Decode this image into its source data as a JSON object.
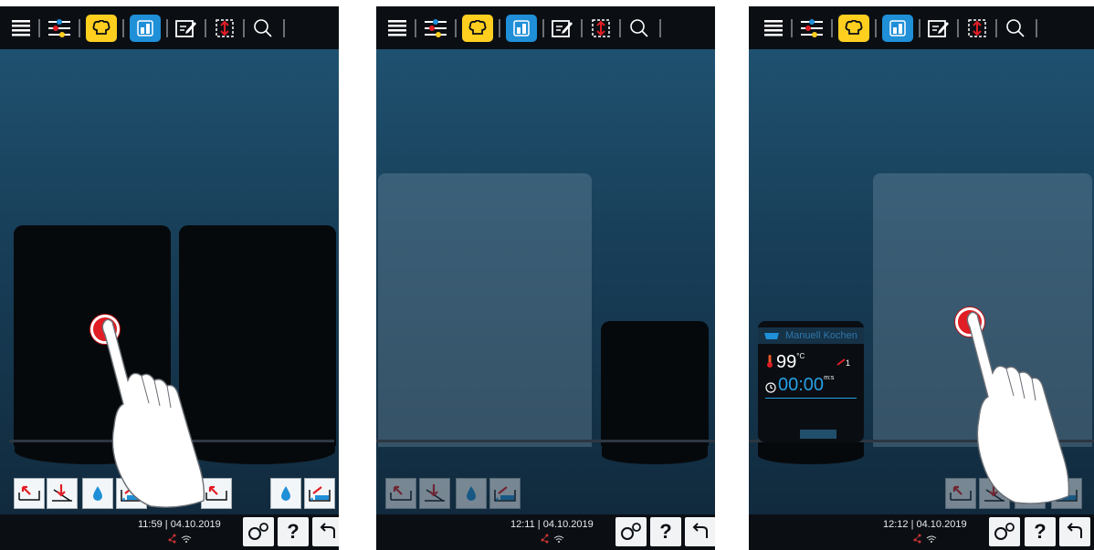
{
  "toolbar": {
    "icons": [
      "menu-icon",
      "sliders-icon",
      "chef-hat-icon",
      "ipanel-icon",
      "notes-icon",
      "resize-icon",
      "search-icon"
    ],
    "colors": {
      "yellow": "#ffcf1f",
      "blue": "#1f8fd8",
      "bar": "#0b0f14"
    }
  },
  "panels": [
    {
      "time": "11:59",
      "date": "04.10.2019",
      "bottom_buttons": [
        "lid-open-icon",
        "lid-close-icon",
        "water-drop-icon",
        "water-fill-icon",
        "lid-open-icon",
        "water-drop-icon",
        "water-fill-icon"
      ]
    },
    {
      "time": "12:11",
      "date": "04.10.2019",
      "bottom_buttons": [
        "lid-open-icon",
        "lid-close-icon",
        "water-drop-icon",
        "water-fill-icon"
      ]
    },
    {
      "time": "12:12",
      "date": "04.10.2019",
      "card": {
        "title": "Manuell Kochen",
        "temperature": "99",
        "temperature_unit": "°C",
        "stir_level": "1",
        "timer": "00:00",
        "timer_unit": "m:s"
      },
      "bottom_buttons": [
        "lid-open-icon",
        "lid-close-icon",
        "water-drop-icon",
        "water-fill-icon"
      ]
    }
  ],
  "status": {
    "separator": "|",
    "settings_label": "settings",
    "help_label": "?",
    "back_label": "back"
  }
}
